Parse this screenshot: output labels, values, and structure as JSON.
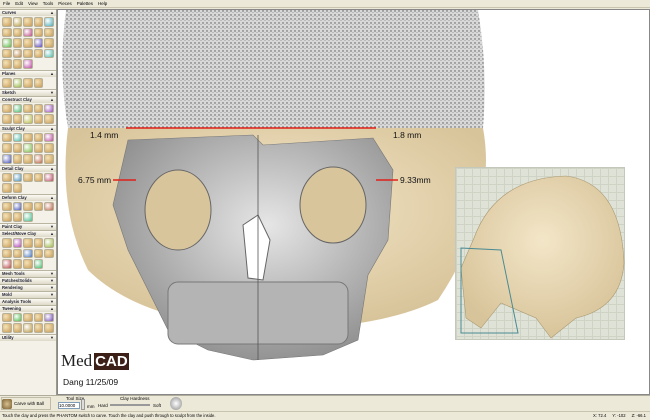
{
  "menu": [
    "File",
    "Edit",
    "View",
    "Tools",
    "Pieces",
    "Palettes",
    "Help"
  ],
  "panel": {
    "sections": [
      {
        "label": "Curves",
        "icons": 23
      },
      {
        "label": "Planes",
        "icons": 4
      },
      {
        "label": "Sketch",
        "icons": 0
      },
      {
        "label": "Construct Clay",
        "icons": 10
      },
      {
        "label": "Sculpt Clay",
        "icons": 15
      },
      {
        "label": "Detail Clay",
        "icons": 7
      },
      {
        "label": "Deform Clay",
        "icons": 8
      },
      {
        "label": "Paint Clay",
        "icons": 0
      },
      {
        "label": "Select/Move Clay",
        "icons": 14
      },
      {
        "label": "Mesh Tools",
        "icons": 0
      },
      {
        "label": "Patches/Solids",
        "icons": 0
      },
      {
        "label": "Rendering",
        "icons": 0
      },
      {
        "label": "Mold",
        "icons": 0
      },
      {
        "label": "Analysis Tools",
        "icons": 0
      },
      {
        "label": "Tweening",
        "icons": 10
      },
      {
        "label": "Utility",
        "icons": 0
      }
    ]
  },
  "viewport": {
    "measurements": {
      "top_left": "1.4 mm",
      "top_right": "1.8 mm",
      "mid_left": "6.75 mm",
      "mid_right": "9.33mm"
    },
    "logo": {
      "med": "Med",
      "cad": "CAD"
    },
    "caption": "Dang 11/25/09",
    "accent": "#e0201a"
  },
  "toolbar": {
    "tool_label": "Carve with Ball",
    "tool_size_label": "Tool Size",
    "tool_size_value": "10.0000",
    "unit": "mm",
    "hardness_label": "Clay Hardness",
    "hard": "Hard",
    "soft": "Soft"
  },
  "status": {
    "message": "Touch the clay and press the PHANTOM switch to carve. Touch the clay and push through to sculpt from the inside.",
    "x": "X: 72.4",
    "y": "Y: -102",
    "z": "Z: -66.1"
  }
}
